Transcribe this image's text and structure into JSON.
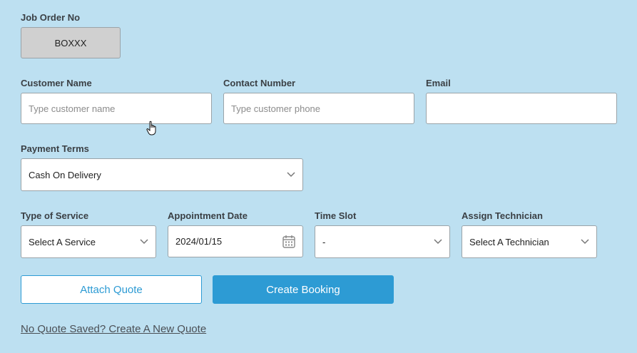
{
  "job_order": {
    "label": "Job Order No",
    "value": "BOXXX"
  },
  "customer_name": {
    "label": "Customer Name",
    "placeholder": "Type customer name"
  },
  "contact_number": {
    "label": "Contact Number",
    "placeholder": "Type customer phone"
  },
  "email": {
    "label": "Email",
    "value": ""
  },
  "payment_terms": {
    "label": "Payment Terms",
    "value": "Cash On Delivery"
  },
  "type_of_service": {
    "label": "Type of Service",
    "value": "Select A Service"
  },
  "appointment_date": {
    "label": "Appointment Date",
    "value": "2024/01/15",
    "icon": "calendar-icon"
  },
  "time_slot": {
    "label": "Time Slot",
    "value": "-"
  },
  "assign_technician": {
    "label": "Assign Technician",
    "value": "Select A Technician"
  },
  "buttons": {
    "attach_quote": "Attach Quote",
    "create_booking": "Create Booking"
  },
  "link": {
    "new_quote": "No Quote Saved? Create A New Quote"
  },
  "colors": {
    "background": "#bde0f1",
    "accent": "#2d9bd4",
    "readonly_field": "#d0d0d0"
  }
}
